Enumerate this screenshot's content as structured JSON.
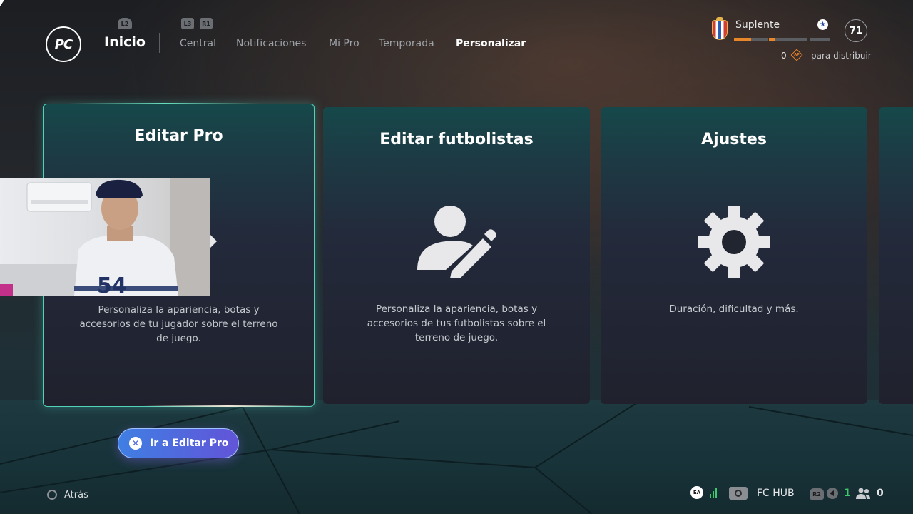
{
  "header": {
    "logo_text": "PC",
    "inicio_label": "Inicio",
    "hints": {
      "l2": "L2",
      "l3": "L3",
      "r1": "R1"
    },
    "nav_tabs": [
      {
        "label": "Central",
        "active": false
      },
      {
        "label": "Notificaciones",
        "active": false
      },
      {
        "label": "Mi Pro",
        "active": false
      },
      {
        "label": "Temporada",
        "active": false
      },
      {
        "label": "Personalizar",
        "active": true
      }
    ]
  },
  "status": {
    "rank_label": "Suplente",
    "ovr": "71",
    "ap_count": "0",
    "ap_icon_text": "AP",
    "ap_text": "para distribuir",
    "progress_segments": [
      0.5,
      0.15,
      0,
      0
    ],
    "accent_color": "#e8862a"
  },
  "cards": [
    {
      "title": "Editar Pro",
      "description": "Personaliza la apariencia, botas y accesorios de tu jugador sobre el terreno de juego.",
      "selected": true
    },
    {
      "title": "Editar futbolistas",
      "description": "Personaliza la apariencia, botas y accesorios de tus futbolistas sobre el terreno de juego.",
      "icon": "edit-person-icon"
    },
    {
      "title": "Ajustes",
      "description": "Duración, dificultad y más.",
      "icon": "gear-icon"
    }
  ],
  "action_button": {
    "label": "Ir a Editar Pro",
    "icon": "cross-button-icon"
  },
  "footer": {
    "back_label": "Atrás",
    "ea_label": "EA",
    "hub_label": "FC HUB",
    "r2_hint": "R2",
    "green_count": "1",
    "party_count": "0"
  }
}
